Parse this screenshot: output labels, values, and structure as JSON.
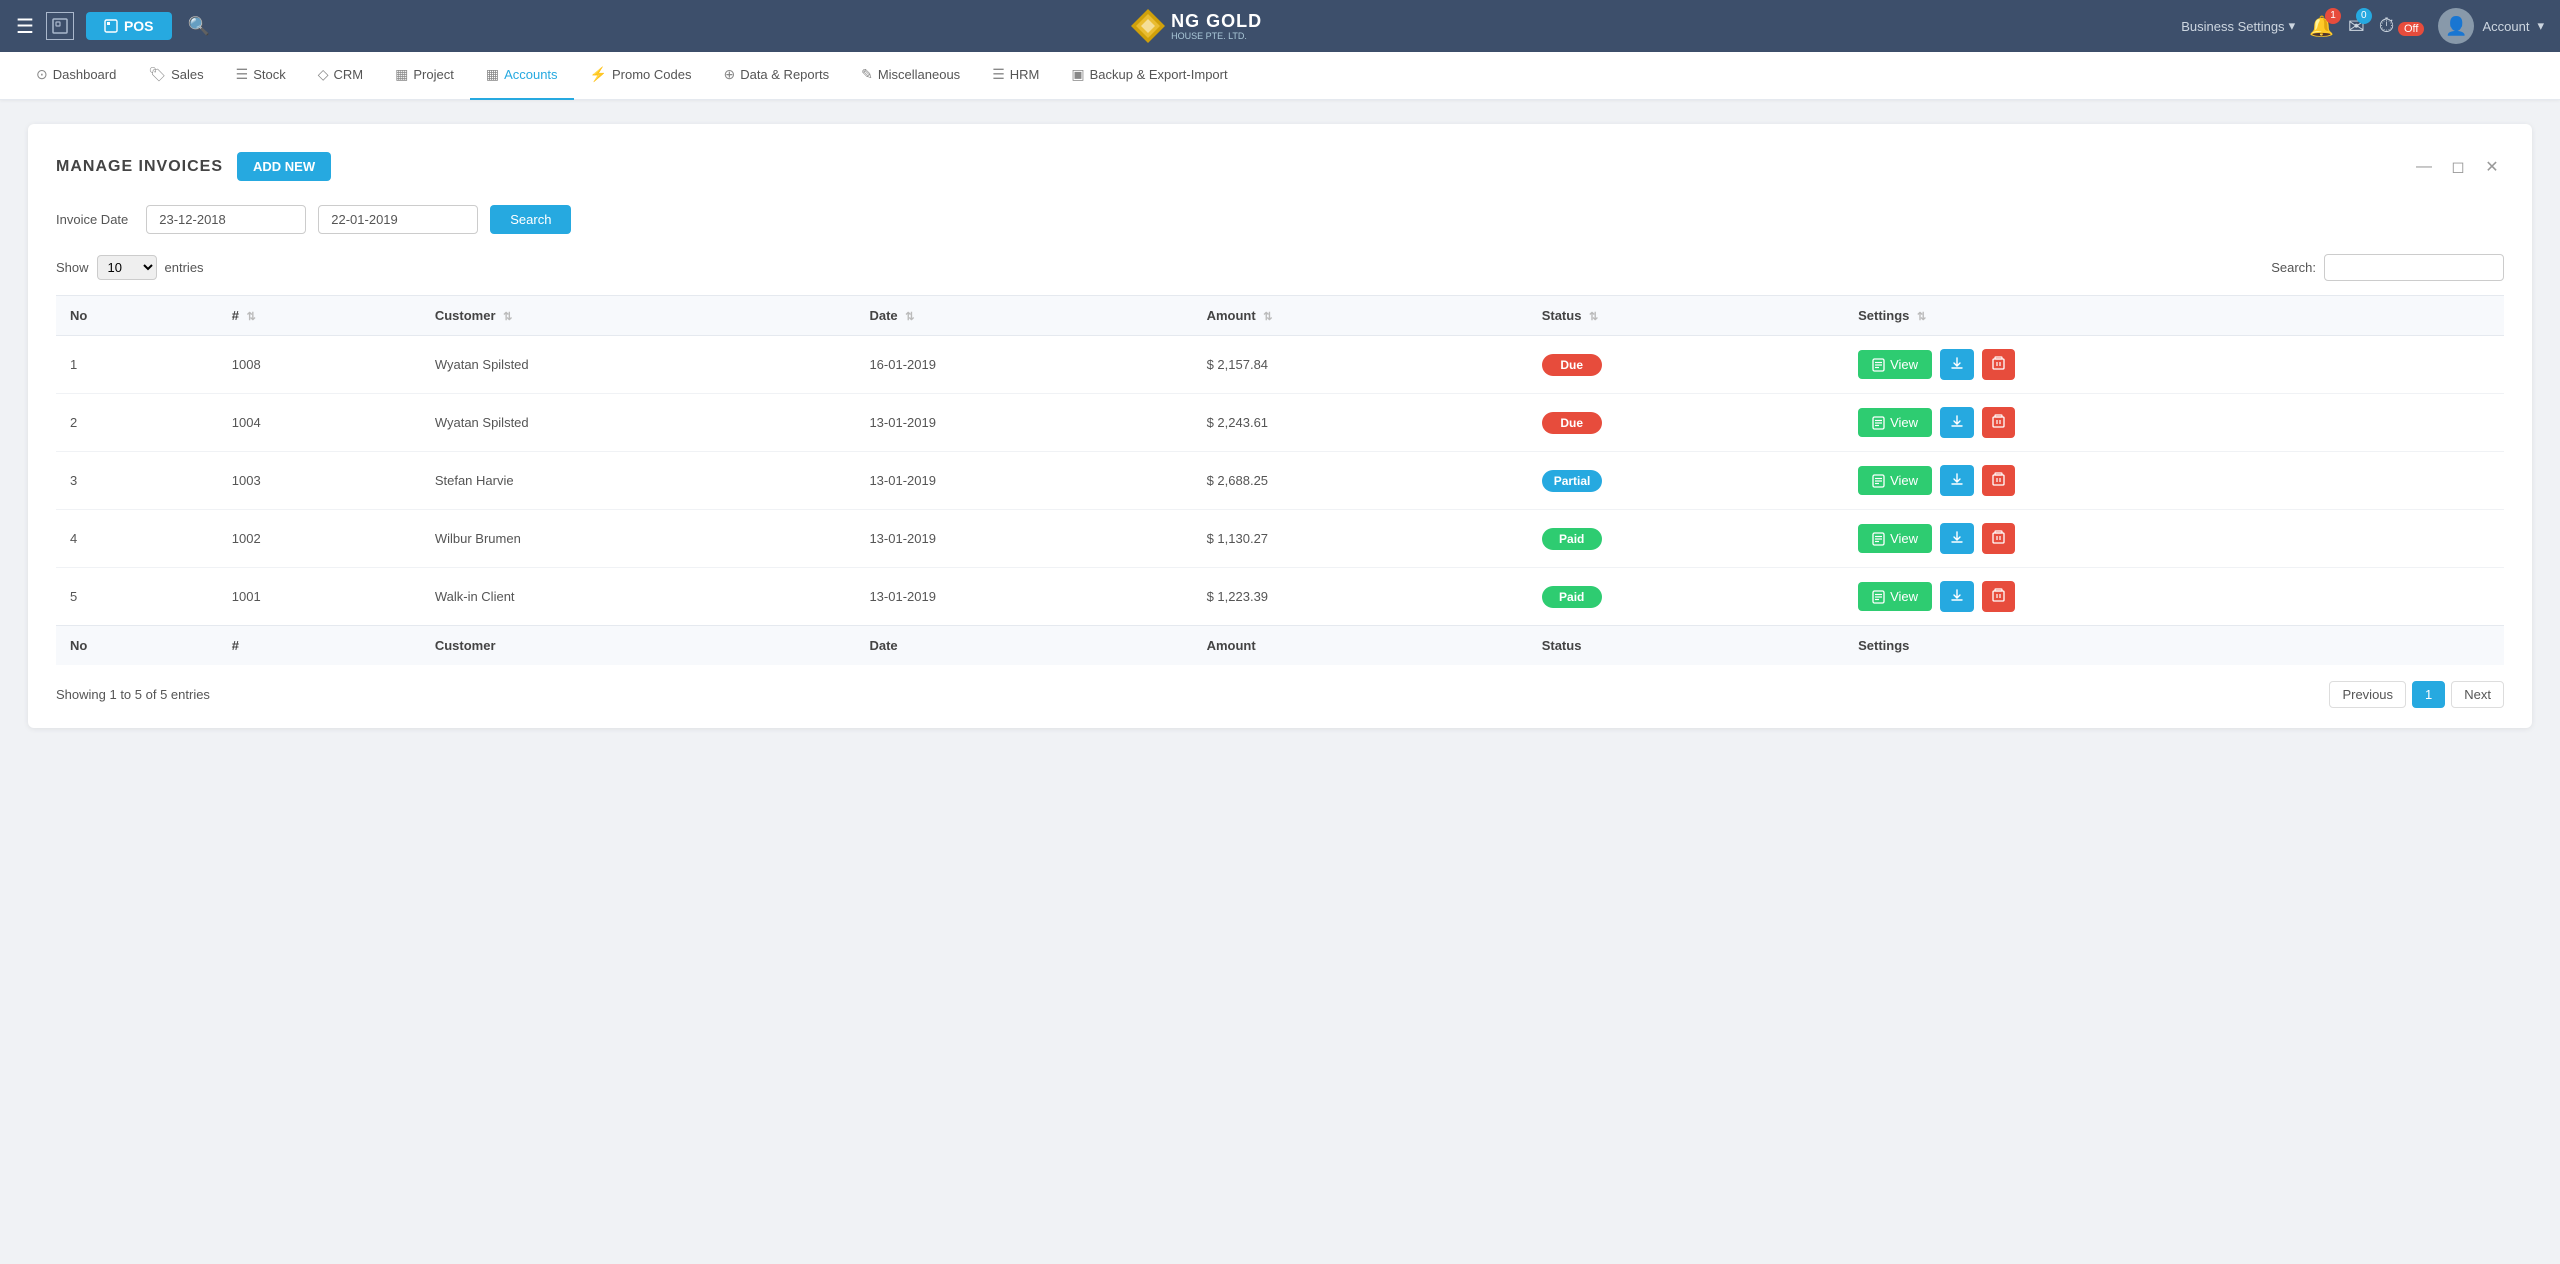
{
  "topbar": {
    "pos_label": "POS",
    "logo_text": "NG GOLD",
    "logo_sub": "HOUSE PTE. LTD.",
    "biz_settings": "Business Settings",
    "account_label": "Account",
    "notification_count": "1",
    "message_count": "0",
    "timer_status": "Off"
  },
  "secondnav": {
    "items": [
      {
        "label": "Dashboard",
        "icon": "⊙"
      },
      {
        "label": "Sales",
        "icon": "🏷"
      },
      {
        "label": "Stock",
        "icon": "☰"
      },
      {
        "label": "CRM",
        "icon": "◇"
      },
      {
        "label": "Project",
        "icon": "▦"
      },
      {
        "label": "Accounts",
        "icon": "▦",
        "active": true
      },
      {
        "label": "Promo Codes",
        "icon": "⚡"
      },
      {
        "label": "Data & Reports",
        "icon": "⊕"
      },
      {
        "label": "Miscellaneous",
        "icon": "✎"
      },
      {
        "label": "HRM",
        "icon": "☰"
      },
      {
        "label": "Backup & Export-Import",
        "icon": "▣"
      }
    ]
  },
  "page": {
    "title": "MANAGE INVOICES",
    "add_new_label": "ADD NEW",
    "invoice_date_label": "Invoice Date",
    "date_from": "23-12-2018",
    "date_to": "22-01-2019",
    "search_btn": "Search",
    "show_label": "Show",
    "entries_label": "entries",
    "entries_value": "10",
    "search_label": "Search:",
    "showing_text": "Showing 1 to 5 of 5 entries"
  },
  "table": {
    "headers": [
      "No",
      "#",
      "Customer",
      "Date",
      "Amount",
      "Status",
      "Settings"
    ],
    "rows": [
      {
        "no": "1",
        "hash": "1008",
        "customer": "Wyatan Spilsted",
        "date": "16-01-2019",
        "amount": "$ 2,157.84",
        "status": "Due",
        "status_class": "status-due"
      },
      {
        "no": "2",
        "hash": "1004",
        "customer": "Wyatan Spilsted",
        "date": "13-01-2019",
        "amount": "$ 2,243.61",
        "status": "Due",
        "status_class": "status-due"
      },
      {
        "no": "3",
        "hash": "1003",
        "customer": "Stefan Harvie",
        "date": "13-01-2019",
        "amount": "$ 2,688.25",
        "status": "Partial",
        "status_class": "status-partial"
      },
      {
        "no": "4",
        "hash": "1002",
        "customer": "Wilbur Brumen",
        "date": "13-01-2019",
        "amount": "$ 1,130.27",
        "status": "Paid",
        "status_class": "status-paid"
      },
      {
        "no": "5",
        "hash": "1001",
        "customer": "Walk-in Client",
        "date": "13-01-2019",
        "amount": "$ 1,223.39",
        "status": "Paid",
        "status_class": "status-paid"
      }
    ],
    "btn_view": "View",
    "btn_prev": "Previous",
    "btn_next": "Next",
    "page_num": "1"
  }
}
